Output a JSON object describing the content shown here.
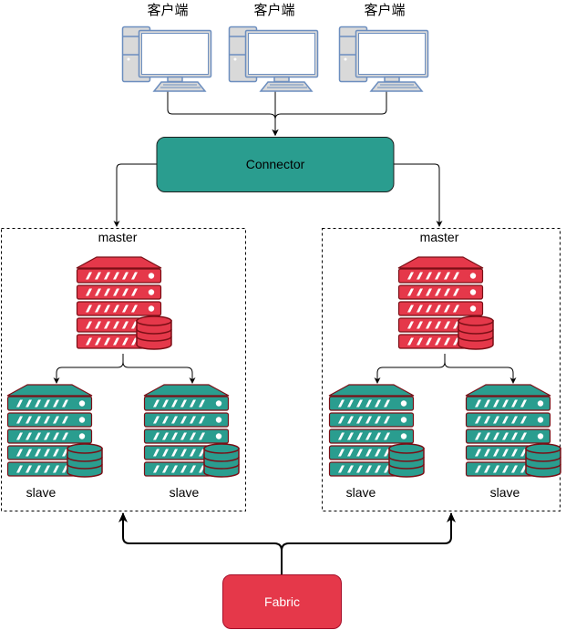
{
  "diagram": {
    "clients": [
      {
        "label": "客户端",
        "icon": "desktop-computer-icon"
      },
      {
        "label": "客户端",
        "icon": "desktop-computer-icon"
      },
      {
        "label": "客户端",
        "icon": "desktop-computer-icon"
      }
    ],
    "connector": {
      "label": "Connector",
      "color": "#2A9D8F"
    },
    "fabric": {
      "label": "Fabric",
      "color": "#E5384A"
    },
    "clusters": [
      {
        "master": {
          "label": "master",
          "icon": "database-server-icon",
          "color": "#E5384A"
        },
        "slaves": [
          {
            "label": "slave",
            "icon": "database-server-icon",
            "color": "#2A9D8F"
          },
          {
            "label": "slave",
            "icon": "database-server-icon",
            "color": "#2A9D8F"
          }
        ]
      },
      {
        "master": {
          "label": "master",
          "icon": "database-server-icon",
          "color": "#E5384A"
        },
        "slaves": [
          {
            "label": "slave",
            "icon": "database-server-icon",
            "color": "#2A9D8F"
          },
          {
            "label": "slave",
            "icon": "database-server-icon",
            "color": "#2A9D8F"
          }
        ]
      }
    ],
    "colors": {
      "server_outline": "#7A0F16",
      "client_outline": "#6C8EBF",
      "client_fill": "#D9D9D9",
      "edge": "#000000"
    }
  }
}
